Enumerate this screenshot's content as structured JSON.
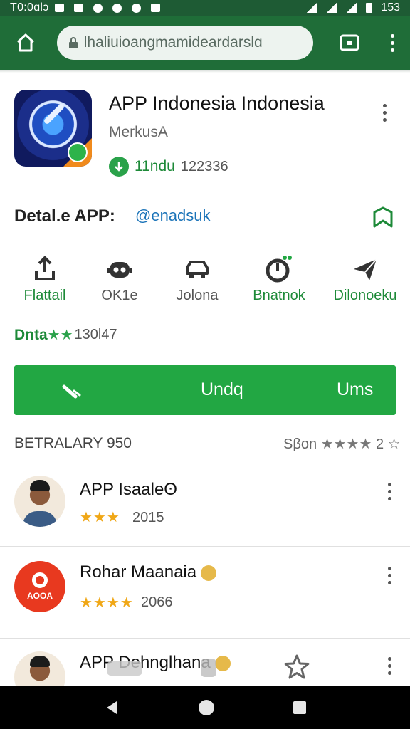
{
  "status_bar": {
    "time": "T0:0ɑlɔ",
    "battery_text": "153"
  },
  "toolbar": {
    "url": "lhaliuioangmamideardarslɑ"
  },
  "app": {
    "title": "APP Indonesia Indonesia",
    "developer": "MerkusA",
    "download_label": "11ndu",
    "download_count": "122336"
  },
  "details": {
    "label": "Detal.e APP:",
    "link": "@enadsuk"
  },
  "actions": [
    {
      "label": "Flattail",
      "icon": "upload-arrow-icon",
      "style": "green"
    },
    {
      "label": "OK1e",
      "icon": "robot-face-icon",
      "style": "gray"
    },
    {
      "label": "Jolona",
      "icon": "car-icon",
      "style": "gray"
    },
    {
      "label": "Bnatnok",
      "icon": "timer-icon",
      "style": "green"
    },
    {
      "label": "Dilonoeku",
      "icon": "send-star-icon",
      "style": "green"
    }
  ],
  "rating": {
    "word": "Dnta",
    "stars": "★★",
    "count": "130l47"
  },
  "install": {
    "label": "Undq",
    "label2": "Ums",
    "icon": "pen-icon"
  },
  "reviews_header": {
    "left": "BETRALARY 950",
    "right_text": "Sβon",
    "right_stars": "★★★★",
    "right_num": "2",
    "right_empty": "☆"
  },
  "reviews": [
    {
      "name": "APP Isaaleʘ",
      "stars": "★★★",
      "number": "2015",
      "avatar": "man-photo-avatar"
    },
    {
      "name": "Rohar Maanaia",
      "stars": "★★★★",
      "number": "2066",
      "avatar": "brand-logo-avatar",
      "brand": "AOOA"
    },
    {
      "name": "APP Dehnglhana",
      "stars": "",
      "number": "",
      "avatar": "man-photo-avatar"
    }
  ],
  "colors": {
    "toolbar": "#1f6d38",
    "status_bar": "#1e5b34",
    "accent_green": "#22a743",
    "star": "#f0a716",
    "link": "#1a73b8"
  }
}
